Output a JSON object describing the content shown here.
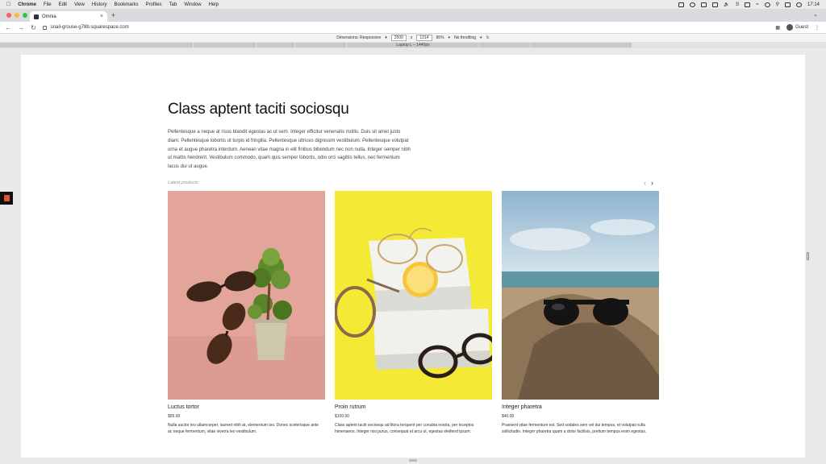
{
  "menubar": {
    "app": "Chrome",
    "items": [
      "File",
      "Edit",
      "View",
      "History",
      "Bookmarks",
      "Profiles",
      "Tab",
      "Window",
      "Help"
    ],
    "clock": "17:14"
  },
  "browser": {
    "tab_title": "Omnia",
    "url": "snail-grouse-g78b.squarespace.com",
    "profile": "Guest"
  },
  "devtools": {
    "dimensions_label": "Dimensions: Responsive",
    "width": "2500",
    "height": "1314",
    "zoom": "95%",
    "throttling": "No throttling",
    "ruler_label": "Laptop L – 1440px"
  },
  "page": {
    "heading": "Class aptent taciti sociosqu",
    "intro": "Pellentesque a neque at risus blandit egestas ac ut sem. Integer efficitur venenatis mollis. Duis sit amet justo diam. Pellentesque lobortis ut turpis id fringilla. Pellentesque ultrices dignissim vestibulum. Pellentesque volutpat urna et augue pharetra interdum. Aenean vitae magna in elit finibus bibendum nec non nulla. Integer semper nibh ut mattis hendrerit. Vestibulum commodo, quam quis semper lobortis, odio orci sagittis tellus, nec fermentum lacus dui ut augue.",
    "latest_label": "Latest products",
    "products": [
      {
        "name": "Luctus tortor",
        "price": "$55.00",
        "description": "Nulla auctor leo ullamcorper, laoreet nibh at, elementum leo. Donec scelerisque ante ac neque fermentum, vitae viverra leo vestibulum."
      },
      {
        "name": "Proin rutrum",
        "price": "$100.00",
        "description": "Class aptent taciti sociosqu ad litora torquent per conubia nostra, per inceptos himenaeos. Integer nisi purus, consequat et arcu ut, egestas eleifend ipsum."
      },
      {
        "name": "Integer pharetra",
        "price": "$40.00",
        "description": "Praesent vitae fermentum est. Sed sodales sem vel dui tempus, et volutpat nulla sollicitudin. Integer pharetra quam a dolor facilisis, pretium tempus enim egestas."
      }
    ]
  }
}
